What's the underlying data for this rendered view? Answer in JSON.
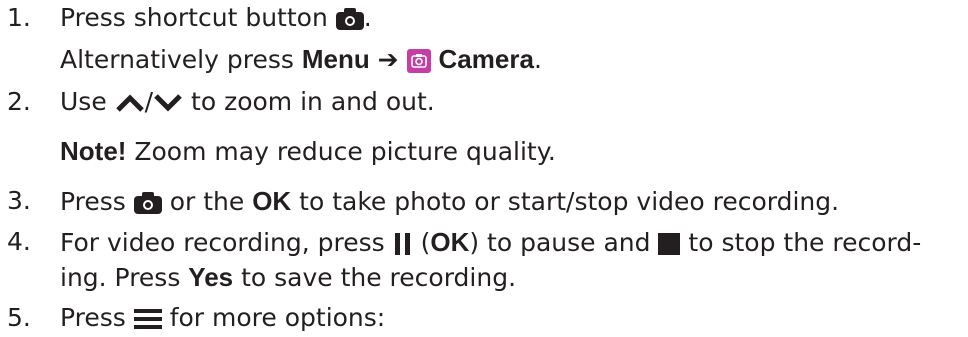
{
  "steps": [
    {
      "number": "1.",
      "line1": {
        "before": "Press shortcut button ",
        "after": "."
      },
      "line2": {
        "before": "Alternatively press ",
        "menu": "Menu",
        "arrow": "➔",
        "camera": "Camera",
        "after": "."
      }
    },
    {
      "number": "2.",
      "before": "Use ",
      "slash": "/",
      "after": " to zoom in and out."
    },
    {
      "note_label": "Note!",
      "note_text": " Zoom may reduce picture quality."
    },
    {
      "number": "3.",
      "before": "Press ",
      "middle": " or the ",
      "ok": "OK",
      "after": " to take photo or start/stop video recording."
    },
    {
      "number": "4.",
      "line1": {
        "before": "For video recording, press ",
        "paren_open": " (",
        "ok": "OK",
        "paren_close": ")",
        "middle": " to pause and ",
        "after": " to stop the record-"
      },
      "line2": {
        "before": "ing. Press ",
        "yes": "Yes",
        "after": " to save the recording."
      }
    },
    {
      "number": "5.",
      "before": "Press ",
      "after": " for more options:"
    }
  ],
  "icons": {
    "camera": "camera-icon",
    "camera_app": "camera-app-icon",
    "up": "chevron-up-icon",
    "down": "chevron-down-icon",
    "pause": "pause-icon",
    "stop": "stop-icon",
    "menu": "menu-icon"
  },
  "colors": {
    "text": "#231f20",
    "camera_app_bg": "#c43ea5"
  }
}
